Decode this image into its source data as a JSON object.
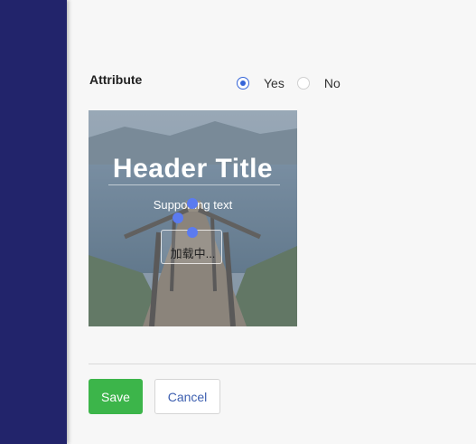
{
  "form": {
    "attribute_label": "Attribute",
    "radio_options": [
      {
        "label": "Yes",
        "checked": true
      },
      {
        "label": "No",
        "checked": false
      }
    ]
  },
  "preview": {
    "header_title": "Header Title",
    "supporting_text": "Supporting text",
    "loading_text": "加载中..."
  },
  "actions": {
    "save_label": "Save",
    "cancel_label": "Cancel"
  },
  "colors": {
    "sidebar": "#22246b",
    "primary": "#3cb54a",
    "accent": "#3565d8"
  }
}
